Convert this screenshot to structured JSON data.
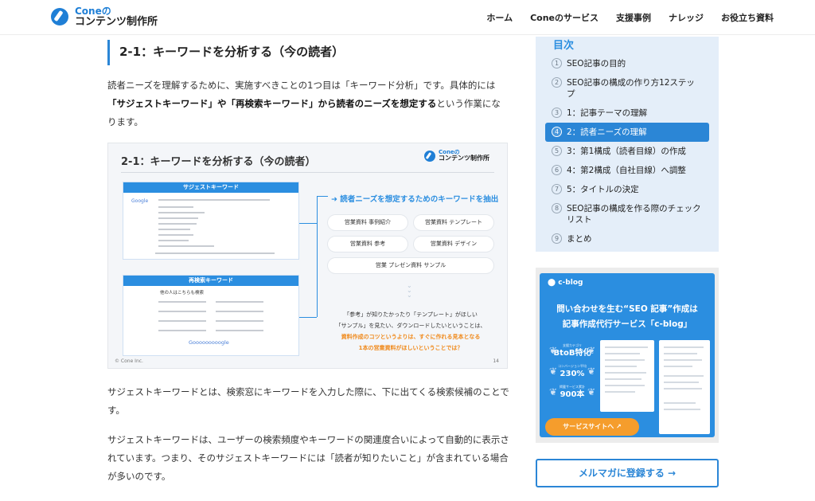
{
  "header": {
    "logo_line1": "Coneの",
    "logo_line2": "コンテンツ制作所",
    "nav": [
      "ホーム",
      "Coneのサービス",
      "支援事例",
      "ナレッジ",
      "お役立ち資料"
    ]
  },
  "article": {
    "heading": "2-1：キーワードを分析する（今の読者）",
    "intro_plain1": "読者ニーズを理解するために、実施すべきことの1つ目は「キーワード分析」です。具体的には",
    "intro_bold": "「サジェストキーワード」や「再検索キーワード」から読者のニーズを想定する",
    "intro_plain2": "という作業になります。",
    "para2": "サジェストキーワードとは、検索窓にキーワードを入力した際に、下に出てくる検索候補のことです。",
    "para3": "サジェストキーワードは、ユーザーの検索頻度やキーワードの関連度合いによって自動的に表示されています。つまり、そのサジェストキーワードには「読者が知りたいこと」が含まれている場合が多いのです。"
  },
  "figure": {
    "title": "2-1：キーワードを分析する（今の読者）",
    "logo_line1": "Coneの",
    "logo_line2": "コンテンツ制作所",
    "panel1_title": "サジェストキーワード",
    "panel2_title": "再検索キーワード",
    "panel2_sub": "他の人はこちらも検索",
    "google_mini": "Google",
    "google_bottom": "Gooooooooogle",
    "subhead": "➜ 読者ニーズを想定するためのキーワードを抽出",
    "chips": [
      "営業資料 事例紹介",
      "営業資料 テンプレート",
      "営業資料 参考",
      "営業資料 デザイン",
      "営業 プレゼン資料 サンプル"
    ],
    "note_line1": "「参考」が知りたかったり「テンプレート」がほしい",
    "note_line2": "「サンプル」を見たい、ダウンロードしたいということは、",
    "note_line3": "資料作成のコツというよりは、すぐに作れる見本となる",
    "note_line4": "1本の営業資料がほしいということでは？",
    "copyright": "© Cone Inc.",
    "page": "14"
  },
  "toc": {
    "title": "目次",
    "items": [
      {
        "num": "1",
        "label": "SEO記事の目的"
      },
      {
        "num": "2",
        "label": "SEO記事の構成の作り方12ステップ"
      },
      {
        "num": "3",
        "label": "1：記事テーマの理解"
      },
      {
        "num": "4",
        "label": "2：読者ニーズの理解"
      },
      {
        "num": "5",
        "label": "3：第1構成（読者目線）の作成"
      },
      {
        "num": "6",
        "label": "4：第2構成（自社目線）へ調整"
      },
      {
        "num": "7",
        "label": "5：タイトルの決定"
      },
      {
        "num": "8",
        "label": "SEO記事の構成を作る際のチェックリスト"
      },
      {
        "num": "9",
        "label": "まとめ"
      }
    ],
    "active_index": 3
  },
  "ad": {
    "brand": "c-blog",
    "headline1": "問い合わせを生む“SEO 記事”作成は",
    "headline2": "記事作成代行サービス「c-blog」",
    "badges": [
      {
        "caption": "支援カテゴリ",
        "value": "BtoB特化"
      },
      {
        "caption": "コンバージョン平均",
        "value": "230%"
      },
      {
        "caption": "掲載サービス累計",
        "value": "900本"
      }
    ],
    "cta": "サービスサイトへ ↗"
  },
  "mailmag": {
    "label": "メルマガに登録する →"
  },
  "colors": {
    "accent": "#2b86d6",
    "orange": "#f59d2c",
    "toc_bg": "#e4eef9"
  }
}
